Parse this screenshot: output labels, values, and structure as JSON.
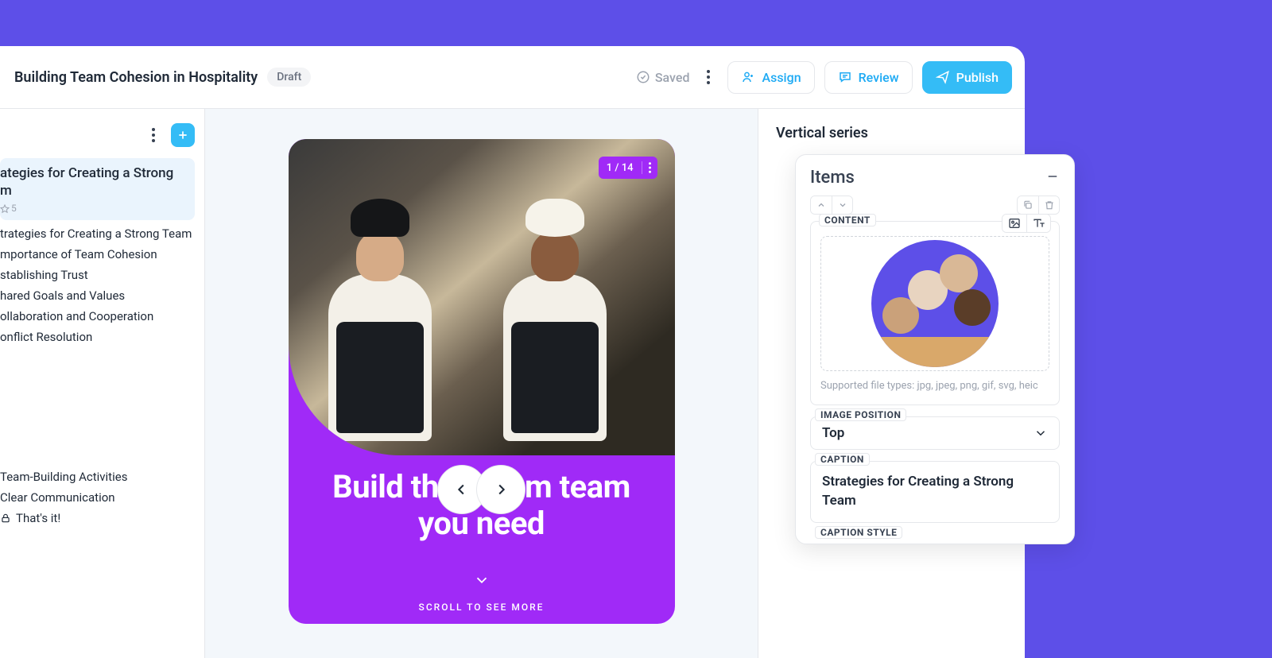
{
  "header": {
    "title": "Building Team Cohesion in Hospitality",
    "badge": "Draft",
    "saved": "Saved",
    "assign": "Assign",
    "review": "Review",
    "publish": "Publish"
  },
  "sidebar": {
    "selected": {
      "title": "ategies for Creating a Strong m",
      "star": "5"
    },
    "items": [
      "trategies for Creating a Strong Team",
      "mportance of Team Cohesion",
      "stablishing Trust",
      "hared Goals and Values",
      "ollaboration and Cooperation",
      "onflict Resolution"
    ],
    "bottom": [
      "Team-Building Activities",
      "Clear Communication",
      "That's it!"
    ]
  },
  "canvas": {
    "counter": "1 / 14",
    "title": "Build the dream team you need",
    "scroll": "SCROLL TO SEE MORE"
  },
  "right": {
    "title": "Vertical series"
  },
  "popup": {
    "title": "Items",
    "content_label": "CONTENT",
    "hint": "Supported file types: jpg, jpeg, png, gif, svg, heic",
    "img_pos_label": "IMAGE POSITION",
    "img_pos_value": "Top",
    "caption_label": "CAPTION",
    "caption_value": "Strategies for Creating a Strong Team",
    "caption_style_label": "CAPTION STYLE"
  }
}
